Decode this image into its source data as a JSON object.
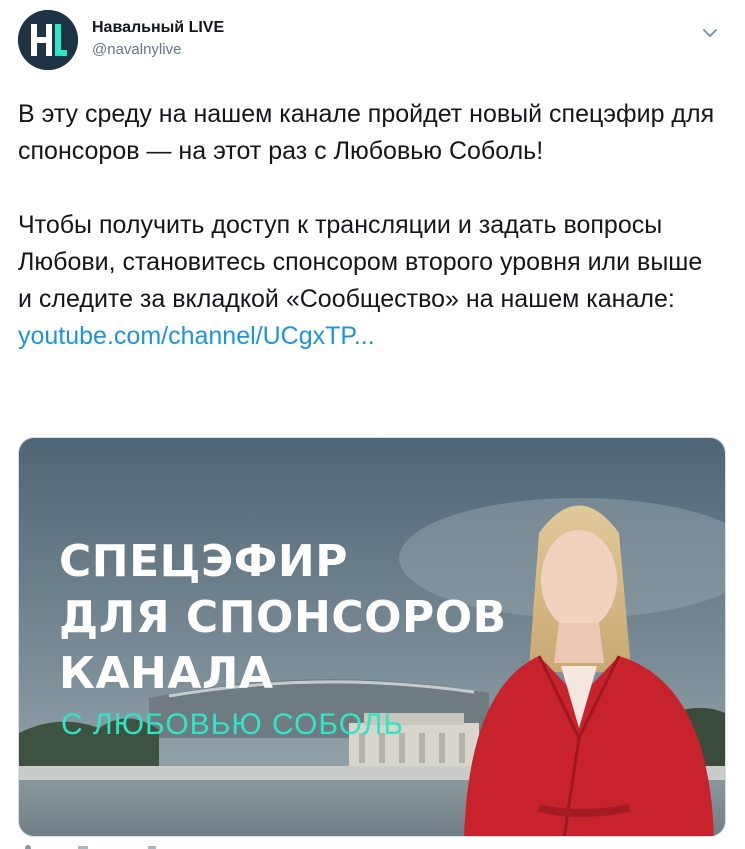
{
  "author": {
    "display_name": "Навальный LIVE",
    "handle": "@navalnylive",
    "avatar_letters": "HL"
  },
  "tweet": {
    "paragraph1": "В эту среду на нашем канале пройдет новый спецэфир для спонсоров — на этот раз с Любовью Соболь!",
    "paragraph2": "Чтобы получить доступ к трансляции и задать вопросы Любови, становитесь спонсором второго уровня или выше и следите за вкладкой «Сообщество» на нашем канале:",
    "link_text": "youtube.com/channel/UCgxTP..."
  },
  "media": {
    "title_line1": "СПЕЦЭФИР",
    "title_line2": "ДЛЯ СПОНСОРОВ",
    "title_line3": "КАНАЛА",
    "subtitle": "С ЛЮБОВЬЮ СОБОЛЬ"
  },
  "colors": {
    "link": "#1b95e0",
    "accent_subtitle": "#2ee6c5",
    "jacket_red": "#c8232c"
  },
  "icons": {
    "caret": "chevron-down-icon"
  }
}
